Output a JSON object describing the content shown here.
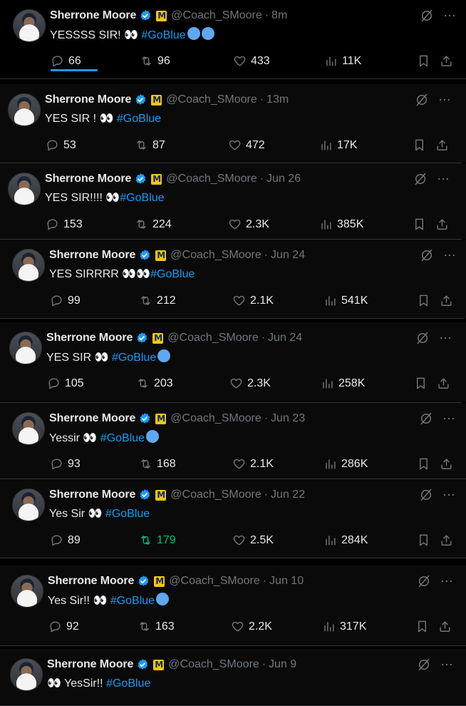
{
  "icons": {
    "verified": "verified-badge-icon",
    "affiliate": "michigan-block-m-badge",
    "grok": "grok-icon",
    "more": "more-icon",
    "reply": "reply-icon",
    "retweet": "retweet-icon",
    "like": "like-icon",
    "views": "views-icon",
    "bookmark": "bookmark-icon",
    "share": "share-icon"
  },
  "colors": {
    "accent": "#1d9bf0",
    "retweeted": "#00ba7c",
    "muted": "#71767b"
  },
  "tweets": [
    {
      "name": "Sherrone Moore",
      "handle": "@Coach_SMoore",
      "dot": "·",
      "time": "8m",
      "text_before": "YESSSS SIR! 👀 ",
      "eyes": "",
      "hashtag": "#GoBlue",
      "circles": 2,
      "replies": "66",
      "retweets": "96",
      "likes": "433",
      "views": "11K",
      "retweeted": false
    },
    {
      "name": "Sherrone Moore",
      "handle": "@Coach_SMoore",
      "dot": "·",
      "time": "13m",
      "text_before": "YES SIR ! 👀 ",
      "eyes": "",
      "hashtag": "#GoBlue",
      "circles": 0,
      "replies": "53",
      "retweets": "87",
      "likes": "472",
      "views": "17K",
      "retweeted": false
    },
    {
      "name": "Sherrone Moore",
      "handle": "@Coach_SMoore",
      "dot": "·",
      "time": "Jun 26",
      "text_before": "YES SIR!!!! 👀",
      "eyes": "",
      "hashtag": "#GoBlue",
      "circles": 0,
      "replies": "153",
      "retweets": "224",
      "likes": "2.3K",
      "views": "385K",
      "retweeted": false
    },
    {
      "name": "Sherrone Moore",
      "handle": "@Coach_SMoore",
      "dot": "·",
      "time": "Jun 24",
      "text_before": "YES SIRRRR 👀👀",
      "eyes": "",
      "hashtag": "#GoBlue",
      "circles": 0,
      "replies": "99",
      "retweets": "212",
      "likes": "2.1K",
      "views": "541K",
      "retweeted": false
    },
    {
      "name": "Sherrone Moore",
      "handle": "@Coach_SMoore",
      "dot": "·",
      "time": "Jun 24",
      "text_before": "YES SIR 👀 ",
      "eyes": "",
      "hashtag": "#GoBlue",
      "circles": 1,
      "replies": "105",
      "retweets": "203",
      "likes": "2.3K",
      "views": "258K",
      "retweeted": false
    },
    {
      "name": "Sherrone Moore",
      "handle": "@Coach_SMoore",
      "dot": "·",
      "time": "Jun 23",
      "text_before": "Yessir 👀 ",
      "eyes": "",
      "hashtag": "#GoBlue",
      "circles": 1,
      "replies": "93",
      "retweets": "168",
      "likes": "2.1K",
      "views": "286K",
      "retweeted": false
    },
    {
      "name": "Sherrone Moore",
      "handle": "@Coach_SMoore",
      "dot": "·",
      "time": "Jun 22",
      "text_before": "Yes Sir 👀 ",
      "eyes": "",
      "hashtag": "#GoBlue",
      "circles": 0,
      "replies": "89",
      "retweets": "179",
      "likes": "2.5K",
      "views": "284K",
      "retweeted": true
    },
    {
      "name": "Sherrone Moore",
      "handle": "@Coach_SMoore",
      "dot": "·",
      "time": "Jun 10",
      "text_before": "Yes Sir!! 👀 ",
      "eyes": "",
      "hashtag": "#GoBlue",
      "circles": 1,
      "replies": "92",
      "retweets": "163",
      "likes": "2.2K",
      "views": "317K",
      "retweeted": false
    },
    {
      "name": "Sherrone Moore",
      "handle": "@Coach_SMoore",
      "dot": "·",
      "time": "Jun 9",
      "text_before": "👀 YesSir!! ",
      "eyes": "",
      "hashtag": "#GoBlue",
      "circles": 0,
      "replies": "",
      "retweets": "",
      "likes": "",
      "views": "",
      "retweeted": false
    }
  ]
}
